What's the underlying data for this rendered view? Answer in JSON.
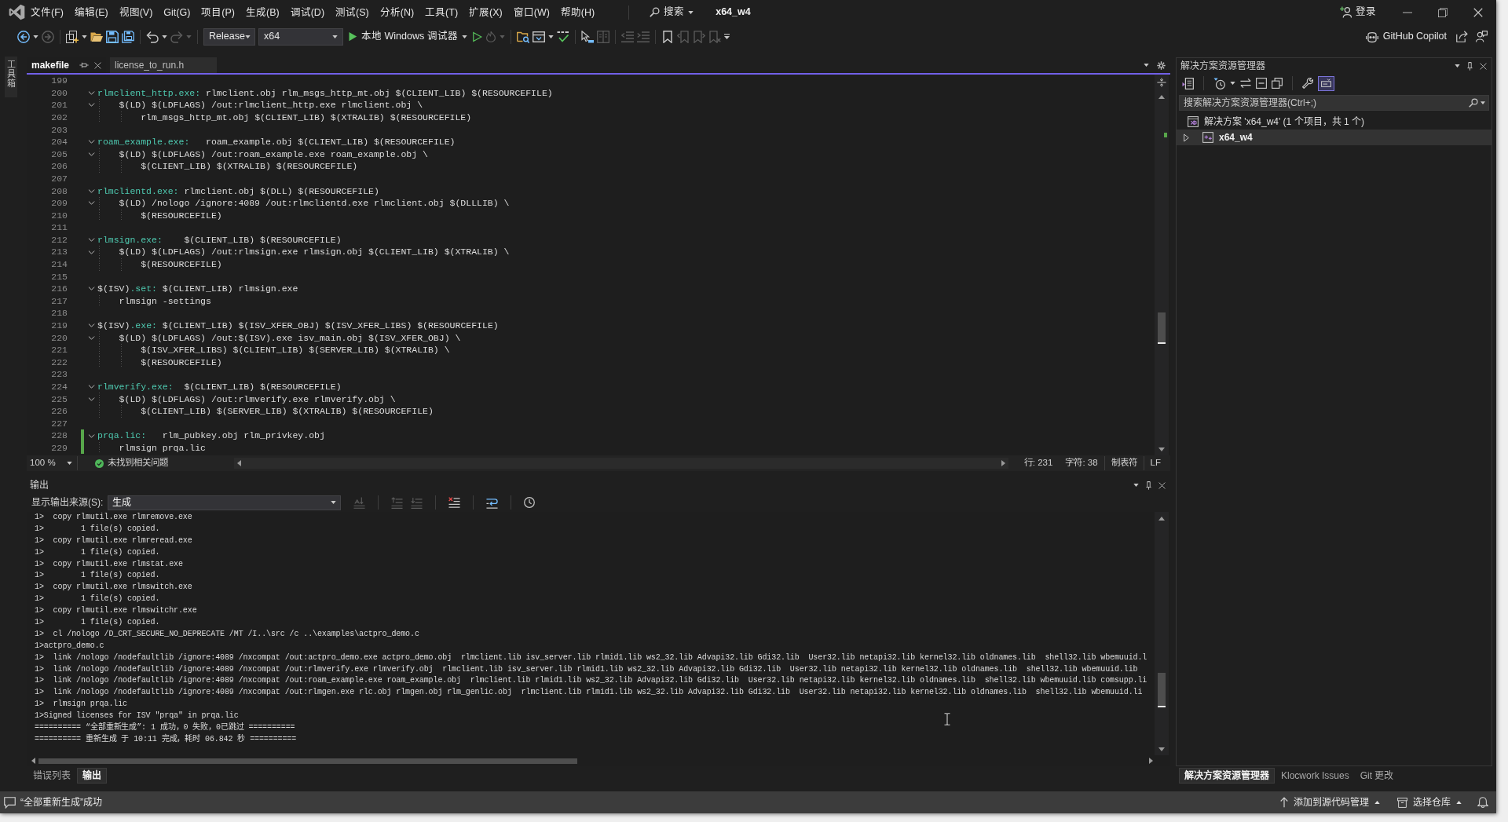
{
  "menu_bar": {
    "items": [
      "文件(F)",
      "编辑(E)",
      "视图(V)",
      "Git(G)",
      "项目(P)",
      "生成(B)",
      "调试(D)",
      "测试(S)",
      "分析(N)",
      "工具(T)",
      "扩展(X)",
      "窗口(W)",
      "帮助(H)"
    ],
    "search": "搜索",
    "solution_name": "x64_w4",
    "sign_in": "登录"
  },
  "toolbar": {
    "configuration": "Release",
    "platform": "x64",
    "debug_target": "本地 Windows 调试器",
    "copilot": "GitHub Copilot"
  },
  "toolbox": {
    "label": "工具箱"
  },
  "editor": {
    "tabs": [
      {
        "label": "makefile",
        "selected": true
      },
      {
        "label": "license_to_run.h",
        "selected": false
      }
    ],
    "lines": [
      {
        "number": "199",
        "changed": false
      },
      {
        "number": "200",
        "changed": false,
        "expanded": true,
        "tokens": [
          {
            "kind": "target",
            "text": "rlmclient_http.exe:"
          },
          {
            "kind": "plain",
            "text": " rlmclient.obj rlm_msgs_http_mt.obj $(CLIENT_LIB) $(RESOURCEFILE)"
          }
        ]
      },
      {
        "number": "201",
        "changed": false,
        "expanded": true,
        "tokens": [
          {
            "kind": "plain",
            "text": "    $(LD) $(LDFLAGS) /out:rlmclient_http.exe rlmclient.obj \\"
          }
        ]
      },
      {
        "number": "202",
        "changed": false,
        "tokens": [
          {
            "kind": "plain",
            "text": "        rlm_msgs_http_mt.obj $(CLIENT_LIB) $(XTRALIB) $(RESOURCEFILE)"
          }
        ]
      },
      {
        "number": "203",
        "changed": false
      },
      {
        "number": "204",
        "changed": false,
        "expanded": true,
        "tokens": [
          {
            "kind": "target",
            "text": "roam_example.exe:"
          },
          {
            "kind": "plain",
            "text": "   roam_example.obj $(CLIENT_LIB) $(RESOURCEFILE)"
          }
        ]
      },
      {
        "number": "205",
        "changed": false,
        "expanded": true,
        "tokens": [
          {
            "kind": "plain",
            "text": "    $(LD) $(LDFLAGS) /out:roam_example.exe roam_example.obj \\"
          }
        ]
      },
      {
        "number": "206",
        "changed": false,
        "tokens": [
          {
            "kind": "plain",
            "text": "        $(CLIENT_LIB) $(XTRALIB) $(RESOURCEFILE)"
          }
        ]
      },
      {
        "number": "207",
        "changed": false
      },
      {
        "number": "208",
        "changed": false,
        "expanded": true,
        "tokens": [
          {
            "kind": "target",
            "text": "rlmclientd.exe:"
          },
          {
            "kind": "plain",
            "text": " rlmclient.obj $(DLL) $(RESOURCEFILE)"
          }
        ]
      },
      {
        "number": "209",
        "changed": false,
        "expanded": true,
        "tokens": [
          {
            "kind": "plain",
            "text": "    $(LD) /nologo /ignore:4089 /out:rlmclientd.exe rlmclient.obj $(DLLLIB) \\"
          }
        ]
      },
      {
        "number": "210",
        "changed": false,
        "tokens": [
          {
            "kind": "plain",
            "text": "        $(RESOURCEFILE)"
          }
        ]
      },
      {
        "number": "211",
        "changed": false
      },
      {
        "number": "212",
        "changed": false,
        "expanded": true,
        "tokens": [
          {
            "kind": "target",
            "text": "rlmsign.exe:"
          },
          {
            "kind": "plain",
            "text": "    $(CLIENT_LIB) $(RESOURCEFILE)"
          }
        ]
      },
      {
        "number": "213",
        "changed": false,
        "expanded": true,
        "tokens": [
          {
            "kind": "plain",
            "text": "    $(LD) $(LDFLAGS) /out:rlmsign.exe rlmsign.obj $(CLIENT_LIB) $(XTRALIB) \\"
          }
        ]
      },
      {
        "number": "214",
        "changed": false,
        "tokens": [
          {
            "kind": "plain",
            "text": "        $(RESOURCEFILE)"
          }
        ]
      },
      {
        "number": "215",
        "changed": false
      },
      {
        "number": "216",
        "changed": false,
        "expanded": true,
        "tokens": [
          {
            "kind": "plain",
            "text": "$(ISV)"
          },
          {
            "kind": "target",
            "text": ".set:"
          },
          {
            "kind": "plain",
            "text": " $(CLIENT_LIB) rlmsign.exe"
          }
        ]
      },
      {
        "number": "217",
        "changed": false,
        "tokens": [
          {
            "kind": "plain",
            "text": "    rlmsign -settings"
          }
        ]
      },
      {
        "number": "218",
        "changed": false
      },
      {
        "number": "219",
        "changed": false,
        "expanded": true,
        "tokens": [
          {
            "kind": "plain",
            "text": "$(ISV)"
          },
          {
            "kind": "target",
            "text": ".exe:"
          },
          {
            "kind": "plain",
            "text": " $(CLIENT_LIB) $(ISV_XFER_OBJ) $(ISV_XFER_LIBS) $(RESOURCEFILE)"
          }
        ]
      },
      {
        "number": "220",
        "changed": false,
        "expanded": true,
        "tokens": [
          {
            "kind": "plain",
            "text": "    $(LD) $(LDFLAGS) /out:$(ISV).exe isv_main.obj $(ISV_XFER_OBJ) \\"
          }
        ]
      },
      {
        "number": "221",
        "changed": false,
        "tokens": [
          {
            "kind": "plain",
            "text": "        $(ISV_XFER_LIBS) $(CLIENT_LIB) $(SERVER_LIB) $(XTRALIB) \\"
          }
        ]
      },
      {
        "number": "222",
        "changed": false,
        "tokens": [
          {
            "kind": "plain",
            "text": "        $(RESOURCEFILE)"
          }
        ]
      },
      {
        "number": "223",
        "changed": false
      },
      {
        "number": "224",
        "changed": false,
        "expanded": true,
        "tokens": [
          {
            "kind": "target",
            "text": "rlmverify.exe:"
          },
          {
            "kind": "plain",
            "text": "  $(CLIENT_LIB) $(RESOURCEFILE)"
          }
        ]
      },
      {
        "number": "225",
        "changed": false,
        "expanded": true,
        "tokens": [
          {
            "kind": "plain",
            "text": "    $(LD) $(LDFLAGS) /out:rlmverify.exe rlmverify.obj \\"
          }
        ]
      },
      {
        "number": "226",
        "changed": false,
        "tokens": [
          {
            "kind": "plain",
            "text": "        $(CLIENT_LIB) $(SERVER_LIB) $(XTRALIB) $(RESOURCEFILE)"
          }
        ]
      },
      {
        "number": "227",
        "changed": false
      },
      {
        "number": "228",
        "changed": true,
        "expanded": true,
        "tokens": [
          {
            "kind": "target",
            "text": "prqa.lic:"
          },
          {
            "kind": "plain",
            "text": "   rlm_pubkey.obj rlm_privkey.obj"
          }
        ]
      },
      {
        "number": "229",
        "changed": true,
        "tokens": [
          {
            "kind": "plain",
            "text": "    rlmsign prqa.lic"
          }
        ]
      }
    ],
    "status": {
      "zoom": "100 %",
      "issues": "未找到相关问题",
      "position_line": "行: 231",
      "position_char": "字符: 38",
      "indentation": "制表符",
      "line_ending": "LF"
    }
  },
  "output": {
    "title": "输出",
    "source_label": "显示输出来源(S):",
    "source": "生成",
    "lines": [
      "1>  copy rlmutil.exe rlmremove.exe",
      "1>        1 file(s) copied.",
      "1>  copy rlmutil.exe rlmreread.exe",
      "1>        1 file(s) copied.",
      "1>  copy rlmutil.exe rlmstat.exe",
      "1>        1 file(s) copied.",
      "1>  copy rlmutil.exe rlmswitch.exe",
      "1>        1 file(s) copied.",
      "1>  copy rlmutil.exe rlmswitchr.exe",
      "1>        1 file(s) copied.",
      "1>  cl /nologo /D_CRT_SECURE_NO_DEPRECATE /MT /I..\\src /c ..\\examples\\actpro_demo.c",
      "1>actpro_demo.c",
      "1>  link /nologo /nodefaultlib /ignore:4089 /nxcompat /out:actpro_demo.exe actpro_demo.obj  rlmclient.lib isv_server.lib rlmid1.lib ws2_32.lib Advapi32.lib Gdi32.lib  User32.lib netapi32.lib kernel32.lib oldnames.lib  shell32.lib wbemuuid.l",
      "1>  link /nologo /nodefaultlib /ignore:4089 /nxcompat /out:rlmverify.exe rlmverify.obj  rlmclient.lib isv_server.lib rlmid1.lib ws2_32.lib Advapi32.lib Gdi32.lib  User32.lib netapi32.lib kernel32.lib oldnames.lib  shell32.lib wbemuuid.lib",
      "1>  link /nologo /nodefaultlib /ignore:4089 /nxcompat /out:roam_example.exe roam_example.obj  rlmclient.lib rlmid1.lib ws2_32.lib Advapi32.lib Gdi32.lib  User32.lib netapi32.lib kernel32.lib oldnames.lib  shell32.lib wbemuuid.lib comsupp.li",
      "1>  link /nologo /nodefaultlib /ignore:4089 /nxcompat /out:rlmgen.exe rlc.obj rlmgen.obj rlm_genlic.obj  rlmclient.lib rlmid1.lib ws2_32.lib Advapi32.lib Gdi32.lib  User32.lib netapi32.lib kernel32.lib oldnames.lib  shell32.lib wbemuuid.li",
      "1>  rlmsign prqa.lic",
      "1>Signed licenses for ISV \"prqa\" in prqa.lic",
      "========== “全部重新生成”: 1 成功，0 失败，0已跳过 ==========",
      "========== 重新生成 于 10:11 完成，耗时 06.842 秒 =========="
    ],
    "tabs": [
      {
        "label": "错误列表",
        "selected": false
      },
      {
        "label": "输出",
        "selected": true
      }
    ]
  },
  "solution_explorer": {
    "title": "解决方案资源管理器",
    "search_placeholder": "搜索解决方案资源管理器(Ctrl+;)",
    "tree": [
      {
        "kind": "solution",
        "label": "解决方案 'x64_w4' (1 个项目，共 1 个)",
        "selected": false,
        "children": [
          {
            "kind": "project",
            "label": "x64_w4",
            "selected": true,
            "expanded": false
          }
        ]
      }
    ],
    "tabs": [
      {
        "label": "解决方案资源管理器",
        "selected": true
      },
      {
        "label": "Klocwork Issues",
        "selected": false
      },
      {
        "label": "Git 更改",
        "selected": false
      }
    ]
  },
  "status_bar": {
    "message": "“全部重新生成”成功",
    "source_control": "添加到源代码管理",
    "repository": "选择仓库"
  }
}
